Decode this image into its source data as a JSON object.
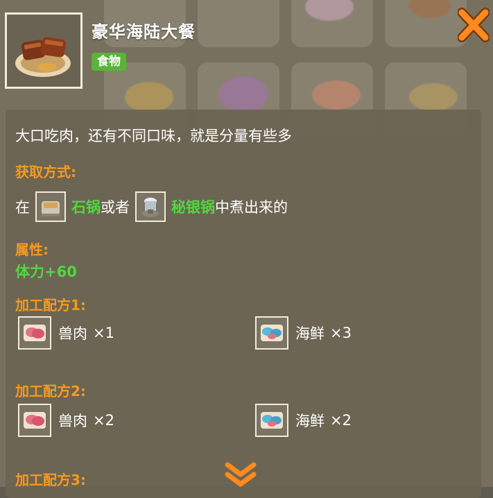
{
  "item": {
    "name": "豪华海陆大餐",
    "tag": "食物",
    "icon": "meat-platter-icon"
  },
  "description": "大口吃肉，还有不同口味，就是分量有些多",
  "source": {
    "label": "获取方式:",
    "prefix": "在",
    "pot1": {
      "name": "石锅",
      "icon": "stone-pot-icon"
    },
    "connector": "或者",
    "pot2": {
      "name": "秘银锅",
      "icon": "mithril-pot-icon"
    },
    "suffix": "中煮出来的"
  },
  "attributes": {
    "label": "属性:",
    "stat": "体力+60"
  },
  "recipes": [
    {
      "label": "加工配方1:",
      "ingredients": [
        {
          "name": "兽肉",
          "qty": "×1",
          "icon": "raw-meat-icon"
        },
        {
          "name": "海鲜",
          "qty": "×3",
          "icon": "seafood-icon"
        }
      ]
    },
    {
      "label": "加工配方2:",
      "ingredients": [
        {
          "name": "兽肉",
          "qty": "×2",
          "icon": "raw-meat-icon"
        },
        {
          "name": "海鲜",
          "qty": "×2",
          "icon": "seafood-icon"
        }
      ]
    },
    {
      "label": "加工配方3:"
    }
  ],
  "colors": {
    "accent": "#f79a1e",
    "green": "#4fd83f",
    "tag": "#5ab43a",
    "panel": "#6c6452"
  }
}
